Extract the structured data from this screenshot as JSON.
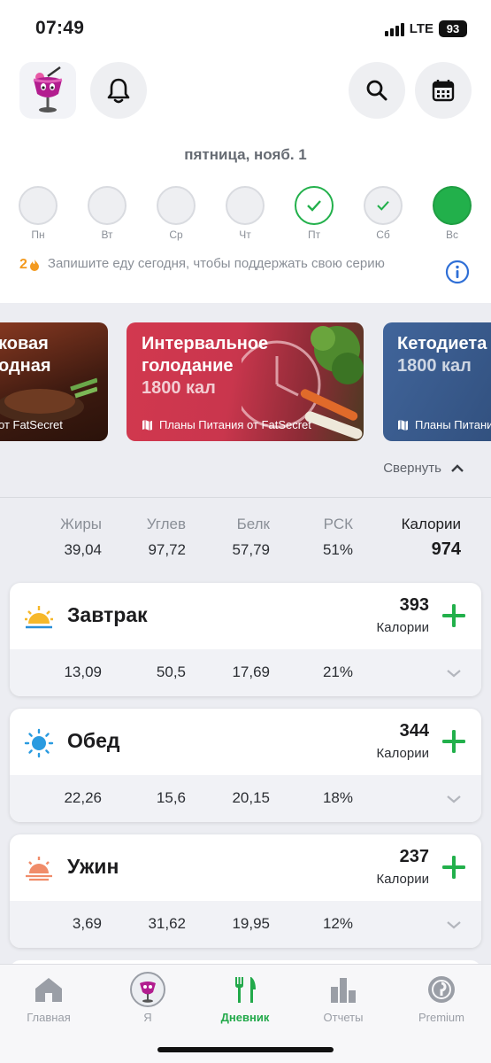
{
  "status_bar": {
    "time": "07:49",
    "network": "LTE",
    "battery": "93"
  },
  "header": {
    "app_icon": "cocktail-avatar-icon",
    "bell_icon": "bell-icon",
    "search_icon": "search-icon",
    "calendar_icon": "calendar-icon"
  },
  "date_title": "пятница, нояб. 1",
  "week": [
    {
      "label": "Пн",
      "state": "empty"
    },
    {
      "label": "Вт",
      "state": "empty"
    },
    {
      "label": "Ср",
      "state": "empty"
    },
    {
      "label": "Чт",
      "state": "empty"
    },
    {
      "label": "Пт",
      "state": "logged"
    },
    {
      "label": "Сб",
      "state": "checked"
    },
    {
      "label": "Вс",
      "state": "today"
    }
  ],
  "streak": {
    "count": "2",
    "text": "Запишите еду сегодня, чтобы поддержать свою серию"
  },
  "meal_plans": [
    {
      "title": "ковая\nодная",
      "kcal": "",
      "source": "от FatSecret",
      "color": "#7a2b1a"
    },
    {
      "title": "Интервальное\nголодание",
      "kcal": "1800 кал",
      "source": "Планы Питания от FatSecret",
      "color": "#c8364e"
    },
    {
      "title": "Кетодиета",
      "kcal": "1800 кал",
      "source": "Планы Питания",
      "color": "#3e5e94"
    }
  ],
  "collapse_label": "Свернуть",
  "totals": {
    "headers": {
      "fat": "Жиры",
      "carbs": "Углев",
      "protein": "Белк",
      "rsk": "РСК",
      "calories": "Калории"
    },
    "values": {
      "fat": "39,04",
      "carbs": "97,72",
      "protein": "57,79",
      "rsk": "51%",
      "calories": "974"
    }
  },
  "meals": [
    {
      "name": "Завтрак",
      "calories": "393",
      "cal_label": "Калории",
      "fat": "13,09",
      "carbs": "50,5",
      "protein": "17,69",
      "rsk": "21%"
    },
    {
      "name": "Обед",
      "calories": "344",
      "cal_label": "Калории",
      "fat": "22,26",
      "carbs": "15,6",
      "protein": "20,15",
      "rsk": "18%"
    },
    {
      "name": "Ужин",
      "calories": "237",
      "cal_label": "Калории",
      "fat": "3,69",
      "carbs": "31,62",
      "protein": "19,95",
      "rsk": "12%"
    }
  ],
  "tabs": [
    {
      "label": "Главная",
      "icon": "home-icon"
    },
    {
      "label": "Я",
      "icon": "profile-avatar-icon"
    },
    {
      "label": "Дневник",
      "icon": "fork-knife-icon",
      "active": true
    },
    {
      "label": "Отчеты",
      "icon": "bar-chart-icon"
    },
    {
      "label": "Premium",
      "icon": "premium-badge-icon"
    }
  ],
  "colors": {
    "accent_green": "#22B04B",
    "streak_orange": "#F39A1F",
    "info_blue": "#2F6FD6"
  }
}
